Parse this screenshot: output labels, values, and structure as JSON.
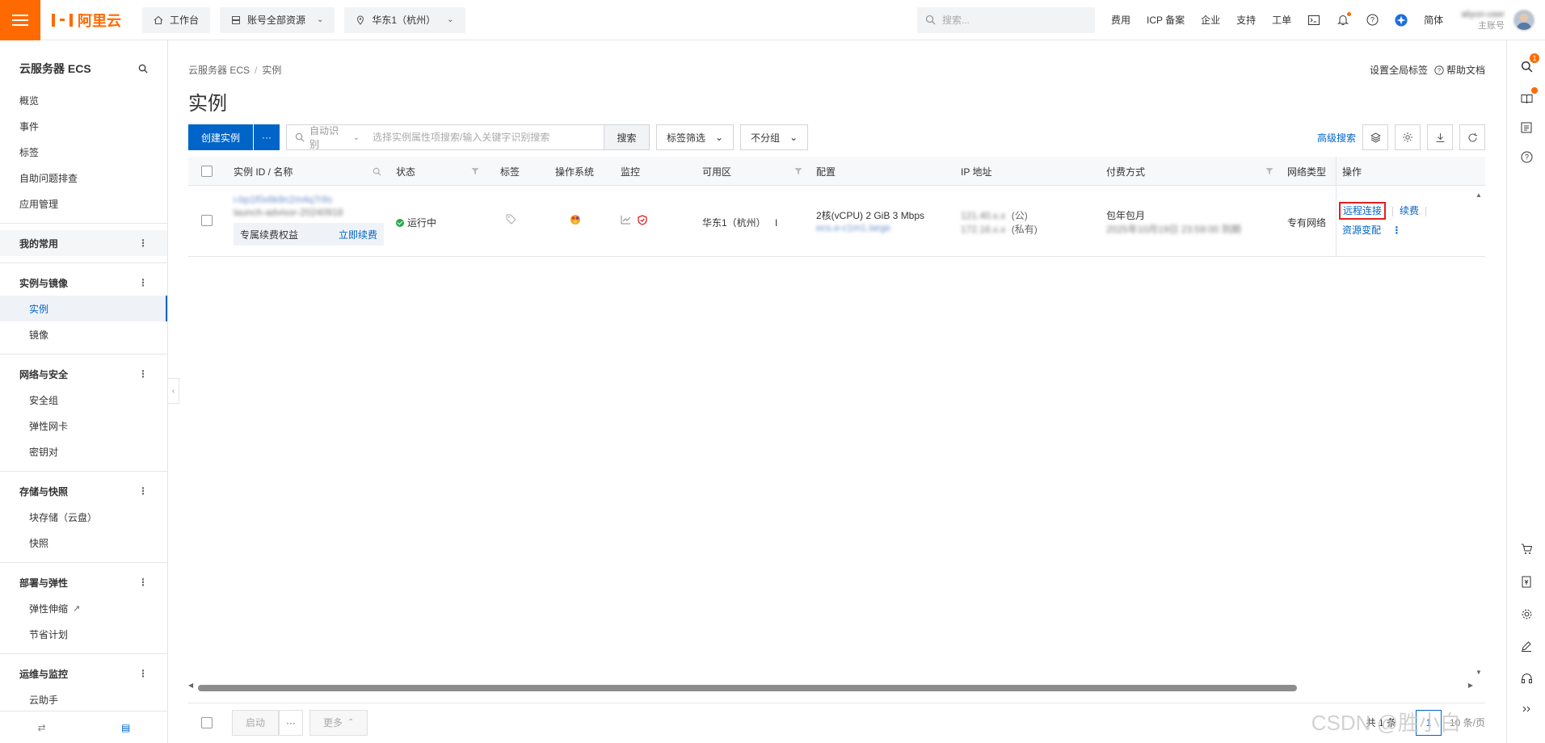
{
  "topbar": {
    "brand": "阿里云",
    "workbench": "工作台",
    "resources": "账号全部资源",
    "region": "华东1（杭州）",
    "search_placeholder": "搜索...",
    "links": [
      "费用",
      "ICP 备案",
      "企业",
      "支持",
      "工单"
    ],
    "language": "简体",
    "user_name": "aliyun-user",
    "user_role": "主账号",
    "accent_color": "#ff6a00"
  },
  "sidebar": {
    "title": "云服务器 ECS",
    "top_items": [
      "概览",
      "事件",
      "标签",
      "自助问题排查",
      "应用管理"
    ],
    "my_common": "我的常用",
    "groups": [
      {
        "title": "实例与镜像",
        "items": [
          "实例",
          "镜像"
        ]
      },
      {
        "title": "网络与安全",
        "items": [
          "安全组",
          "弹性网卡",
          "密钥对"
        ]
      },
      {
        "title": "存储与快照",
        "items": [
          "块存储（云盘）",
          "快照"
        ]
      },
      {
        "title": "部署与弹性",
        "items": [
          "弹性伸缩",
          "节省计划"
        ]
      },
      {
        "title": "运维与监控",
        "items": [
          "云助手"
        ]
      }
    ],
    "active_item": "实例"
  },
  "main": {
    "breadcrumb": [
      "云服务器 ECS",
      "实例"
    ],
    "title": "实例",
    "set_global_tag": "设置全局标签",
    "help_doc": "帮助文档",
    "create_button": "创建实例",
    "more_button": "···",
    "search_prefix": "自动识别",
    "search_placeholder": "选择实例属性项搜索/输入关键字识别搜索",
    "search_button": "搜索",
    "tag_filter": "标签筛选",
    "group_select": "不分组",
    "advanced_search": "高级搜索"
  },
  "table": {
    "columns": [
      "实例 ID / 名称",
      "状态",
      "标签",
      "操作系统",
      "监控",
      "可用区",
      "配置",
      "IP 地址",
      "付费方式",
      "网络类型",
      "操作"
    ],
    "rows": [
      {
        "instance_id": "i-bp1f0x6k8n2m4q7r9s",
        "instance_name": "launch-advisor-20240918",
        "badge": "专属续费权益",
        "badge_link": "立即续费",
        "status": "运行中",
        "zone": "华东1（杭州）",
        "zone_suffix": "I",
        "config_spec": "2核(vCPU)  2 GiB  3 Mbps",
        "config_type": "ecs.e-c1m1.large",
        "ip_public": "121.40.x.x",
        "ip_public_suffix": "(公)",
        "ip_private": "172.16.x.x",
        "ip_private_suffix": "(私有)",
        "billing": "包年包月",
        "billing_detail": "2025年10月19日 23:59:00 到期",
        "network": "专有网络",
        "actions": {
          "remote": "远程连接",
          "renew": "续费",
          "change": "资源变配",
          "more": "⋮"
        }
      }
    ]
  },
  "footer": {
    "start_button": "启动",
    "more_button": "更多",
    "total": "共 1 条",
    "page": "1",
    "page_size": "10 条/页",
    "watermark": "CSDN @胜小白"
  }
}
